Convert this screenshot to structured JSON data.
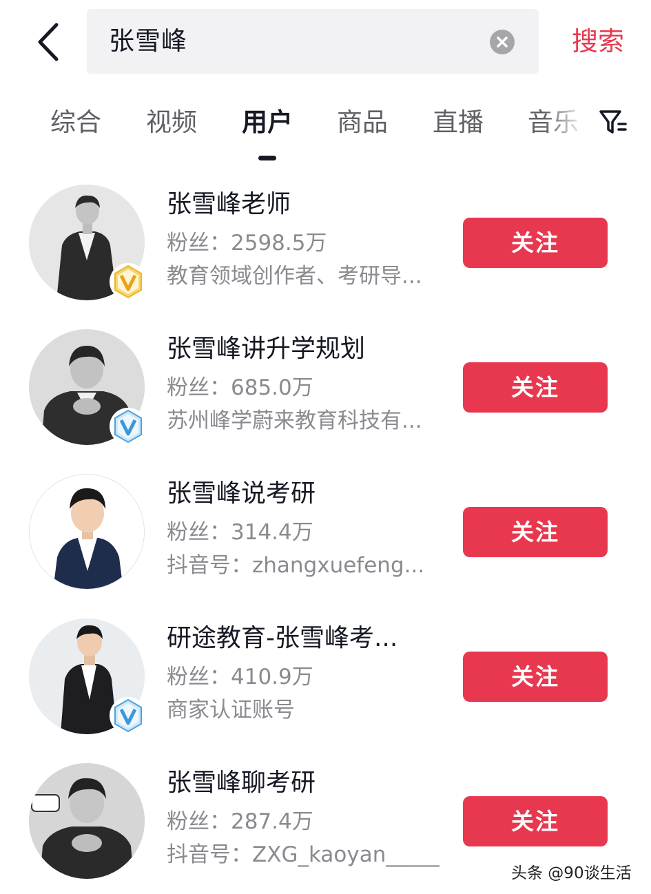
{
  "search": {
    "query": "张雪峰",
    "submit_label": "搜索"
  },
  "tabs": [
    {
      "label": "综合",
      "active": false
    },
    {
      "label": "视频",
      "active": false
    },
    {
      "label": "用户",
      "active": true
    },
    {
      "label": "商品",
      "active": false
    },
    {
      "label": "直播",
      "active": false
    },
    {
      "label": "音乐",
      "active": false
    }
  ],
  "colors": {
    "accent": "#e8384f",
    "verified_gold": "#f0b429",
    "verified_blue": "#4aa3e0"
  },
  "users": [
    {
      "name": "张雪峰老师",
      "fans": "粉丝：2598.5万",
      "desc": "教育领域创作者、考研导...",
      "follow_label": "关注",
      "badge": "gold-verified-icon"
    },
    {
      "name": "张雪峰讲升学规划",
      "fans": "粉丝：685.0万",
      "desc": "苏州峰学蔚来教育科技有...",
      "follow_label": "关注",
      "badge": "blue-verified-icon"
    },
    {
      "name": "张雪峰说考研",
      "fans": "粉丝：314.4万",
      "desc": "抖音号：zhangxuefeng...",
      "follow_label": "关注",
      "badge": ""
    },
    {
      "name": "研途教育-张雪峰考...",
      "fans": "粉丝：410.9万",
      "desc": "商家认证账号",
      "follow_label": "关注",
      "badge": "blue-verified-icon"
    },
    {
      "name": "张雪峰聊考研",
      "fans": "粉丝：287.4万",
      "desc": "抖音号：ZXG_kaoyan_____",
      "follow_label": "关注",
      "badge": ""
    }
  ],
  "watermark": "头条 @90谈生活"
}
